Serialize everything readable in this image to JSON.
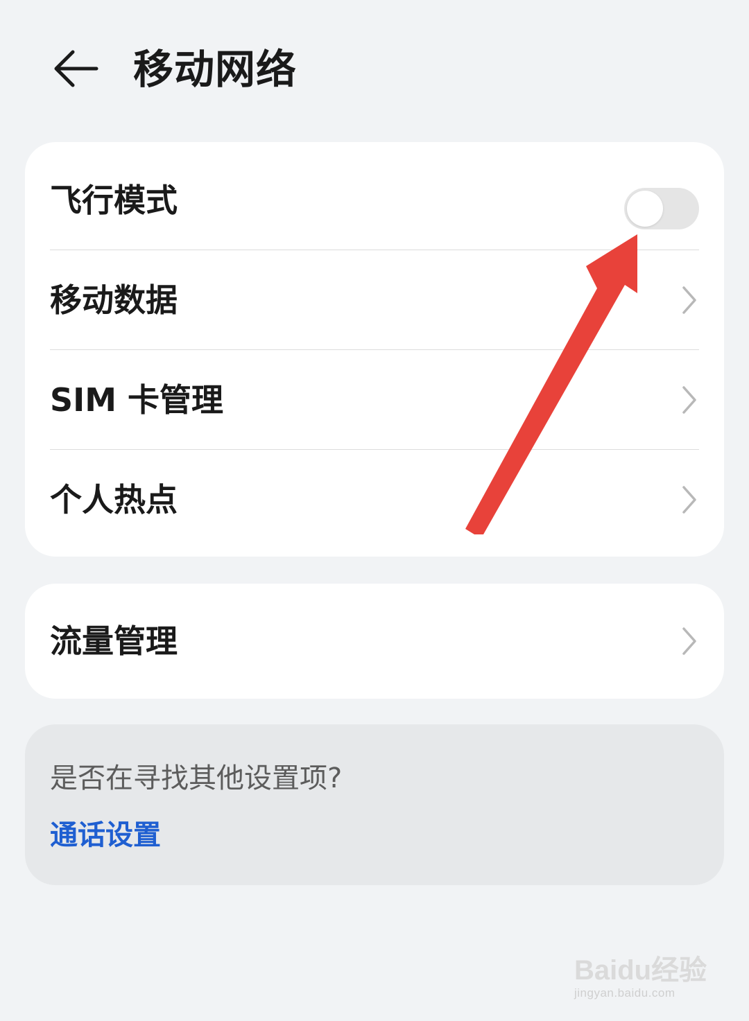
{
  "header": {
    "back_icon": "arrow-left-icon",
    "title": "移动网络"
  },
  "main_card": {
    "items": [
      {
        "label": "飞行模式",
        "control": "toggle",
        "toggle_on": false
      },
      {
        "label": "移动数据",
        "control": "chevron-right-icon"
      },
      {
        "label": "SIM 卡管理",
        "control": "chevron-right-icon"
      },
      {
        "label": "个人热点",
        "control": "chevron-right-icon"
      }
    ]
  },
  "traffic_card": {
    "items": [
      {
        "label": "流量管理",
        "control": "chevron-right-icon"
      }
    ]
  },
  "hint": {
    "question": "是否在寻找其他设置项?",
    "link": "通话设置"
  },
  "colors": {
    "background": "#f1f3f5",
    "card": "#ffffff",
    "hint_card": "#e6e8ea",
    "link": "#1f5fd1",
    "annotation_arrow": "#e8423a",
    "toggle_off": "#e5e5e5"
  },
  "watermark": {
    "logo": "Baidu经验",
    "url": "jingyan.baidu.com"
  }
}
